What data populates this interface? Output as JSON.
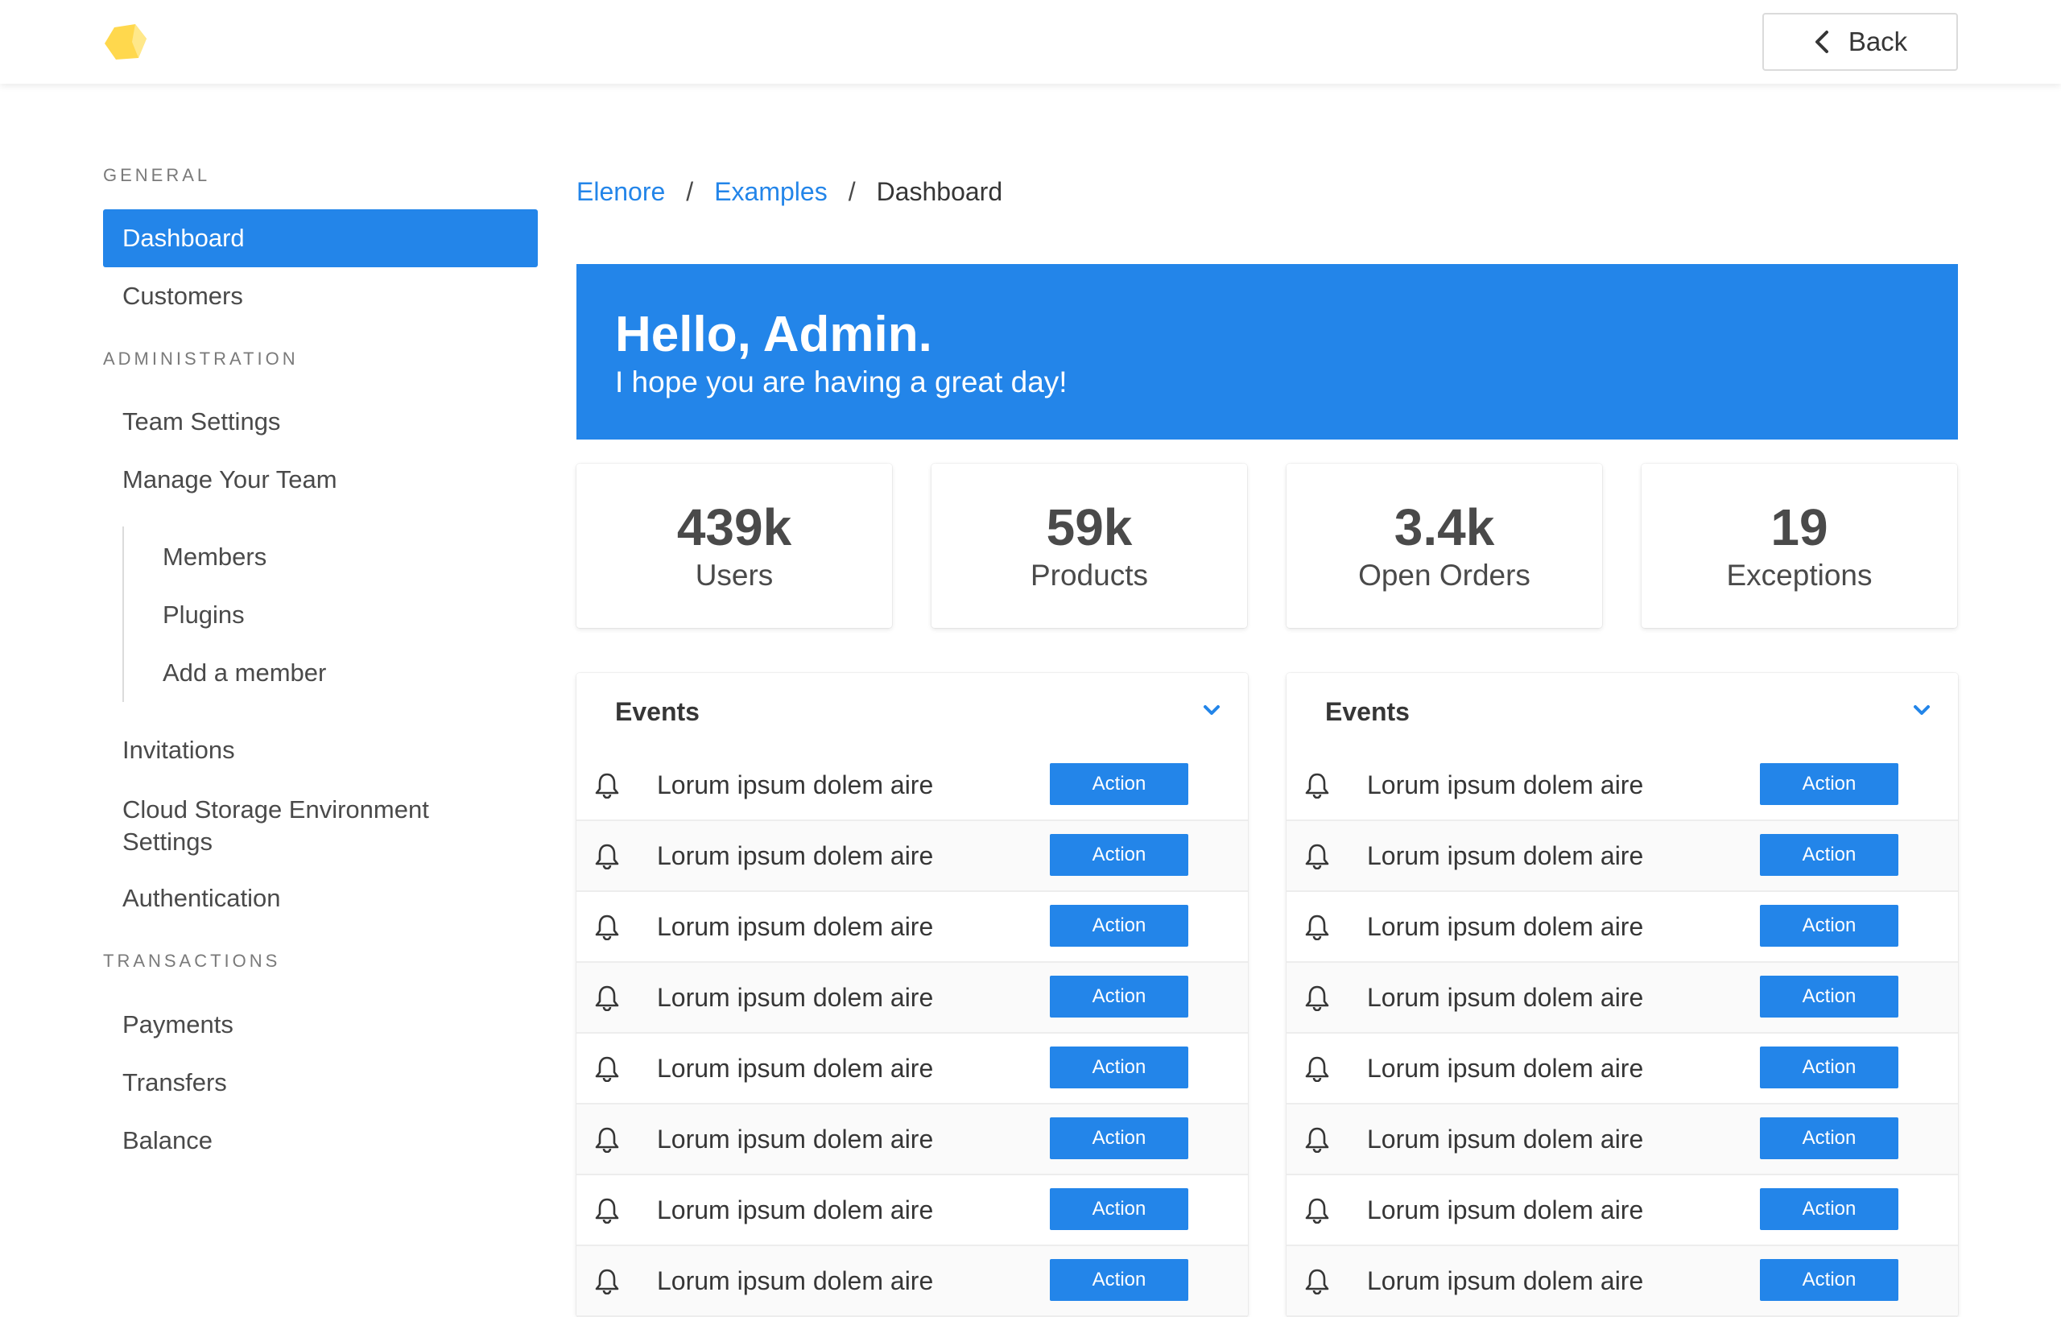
{
  "header": {
    "back_label": "Back",
    "brand_color": "#ffd84d"
  },
  "sidebar": {
    "general_label": "General",
    "general_items": [
      "Dashboard",
      "Customers"
    ],
    "admin_label": "Administration",
    "admin_items": [
      "Team Settings",
      "Manage Your Team"
    ],
    "team_subitems": [
      "Members",
      "Plugins",
      "Add a member"
    ],
    "admin_items_2": [
      "Invitations",
      "Cloud Storage Environment Settings",
      "Authentication"
    ],
    "transactions_label": "Transactions",
    "transactions_items": [
      "Payments",
      "Transfers",
      "Balance"
    ]
  },
  "breadcrumb": {
    "items": [
      "Elenore",
      "Examples"
    ],
    "current": "Dashboard",
    "separator": "/"
  },
  "hero": {
    "title": "Hello, Admin.",
    "subtitle": "I hope you are having a great day!"
  },
  "tiles": [
    {
      "value": "439k",
      "label": "Users"
    },
    {
      "value": "59k",
      "label": "Products"
    },
    {
      "value": "3.4k",
      "label": "Open Orders"
    },
    {
      "value": "19",
      "label": "Exceptions"
    }
  ],
  "cards": [
    {
      "title": "Events",
      "rows": [
        {
          "text": "Lorum ipsum dolem aire",
          "action": "Action"
        },
        {
          "text": "Lorum ipsum dolem aire",
          "action": "Action"
        },
        {
          "text": "Lorum ipsum dolem aire",
          "action": "Action"
        },
        {
          "text": "Lorum ipsum dolem aire",
          "action": "Action"
        },
        {
          "text": "Lorum ipsum dolem aire",
          "action": "Action"
        },
        {
          "text": "Lorum ipsum dolem aire",
          "action": "Action"
        },
        {
          "text": "Lorum ipsum dolem aire",
          "action": "Action"
        },
        {
          "text": "Lorum ipsum dolem aire",
          "action": "Action"
        }
      ]
    },
    {
      "title": "Events",
      "rows": [
        {
          "text": "Lorum ipsum dolem aire",
          "action": "Action"
        },
        {
          "text": "Lorum ipsum dolem aire",
          "action": "Action"
        },
        {
          "text": "Lorum ipsum dolem aire",
          "action": "Action"
        },
        {
          "text": "Lorum ipsum dolem aire",
          "action": "Action"
        },
        {
          "text": "Lorum ipsum dolem aire",
          "action": "Action"
        },
        {
          "text": "Lorum ipsum dolem aire",
          "action": "Action"
        },
        {
          "text": "Lorum ipsum dolem aire",
          "action": "Action"
        },
        {
          "text": "Lorum ipsum dolem aire",
          "action": "Action"
        }
      ]
    }
  ],
  "colors": {
    "accent": "#2385e9",
    "text": "#363636"
  }
}
